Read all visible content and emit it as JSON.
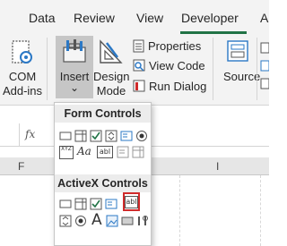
{
  "ribbon_tabs": [
    "Data",
    "Review",
    "View",
    "Developer",
    "A"
  ],
  "active_tab": "Developer",
  "groups": {
    "com_addins": {
      "line1": "COM",
      "line2": "Add-ins"
    },
    "insert": {
      "label": "Insert",
      "dropdown_arrow": "⌄"
    },
    "design_mode": {
      "line1": "Design",
      "line2": "Mode"
    },
    "properties": "Properties",
    "view_code": "View Code",
    "run_dialog": "Run Dialog",
    "source": "Source"
  },
  "formula_bar": {
    "fx": "fx"
  },
  "column_headers": [
    "F",
    "I"
  ],
  "dropdown": {
    "form_controls_title": "Form Controls",
    "activex_controls_title": "ActiveX Controls",
    "form_controls": [
      [
        "button",
        "combo-box",
        "check-box",
        "spin-button",
        "list-box",
        "option-button"
      ],
      [
        "group-box",
        "label",
        "text-field",
        "combo-list-edit",
        "combo-drop-down-edit"
      ]
    ],
    "form_control_glyphs": {
      "group_box": "XYZ",
      "label": "Aa",
      "text_field": "abl"
    },
    "activex_controls": [
      [
        "command-button",
        "combo-box",
        "check-box",
        "list-box",
        "text-box"
      ],
      [
        "scroll-bar",
        "option-button",
        "label",
        "image",
        "toggle-button",
        "more-controls"
      ]
    ],
    "activex_control_glyphs": {
      "text_box": "abl",
      "label": "A"
    },
    "highlighted_control": "text-box"
  },
  "colors": {
    "accent": "#217346",
    "highlight": "#d02b2b",
    "ribbon_bg": "#f3f3f3"
  }
}
